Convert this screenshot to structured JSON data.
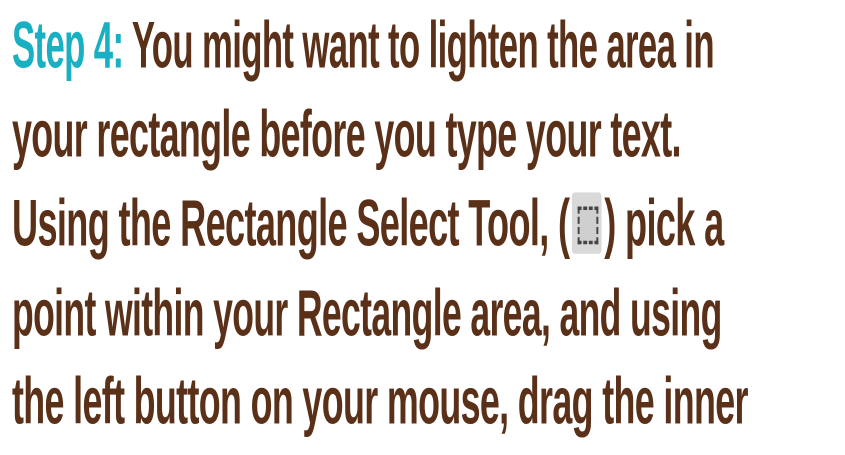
{
  "paragraph": {
    "step_label": "Step 4:",
    "line1": "You might want to lighten the area in",
    "line2": "your rectangle before you type your text.",
    "line3_before_icon": "Using the Rectangle Select Tool, (",
    "line3_after_icon": ") pick a",
    "line4": "point within your Rectangle area, and using",
    "line5": "the left button on your mouse, drag the inner"
  },
  "icons": {
    "tool_icon": "rectangle-select-icon"
  },
  "colors": {
    "text": "#5a3118",
    "step": "#1ab0c3"
  }
}
